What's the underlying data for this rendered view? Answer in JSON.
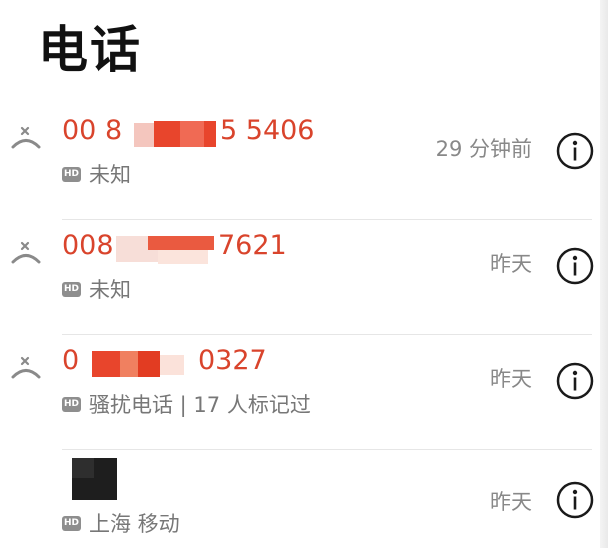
{
  "header": {
    "title": "电话"
  },
  "calls": [
    {
      "number_prefix": "00 8",
      "number_suffix": "5 5406",
      "location": "未知",
      "time": "29 分钟前",
      "badge": "HD",
      "missed": true
    },
    {
      "number_prefix": "008",
      "number_suffix": "7621",
      "location": "未知",
      "time": "昨天",
      "badge": "HD",
      "missed": true
    },
    {
      "number_prefix": "0",
      "number_suffix": "0327",
      "location": "骚扰电话 | 17 人标记过",
      "time": "昨天",
      "badge": "HD",
      "missed": true
    },
    {
      "location": "上海 移动",
      "time": "昨天",
      "badge": "HD",
      "missed": false
    }
  ],
  "icons": {
    "missed_call": "missed-call-icon",
    "info": "info-icon",
    "hd": "hd-badge"
  },
  "colors": {
    "missed_number": "#d9442c",
    "secondary_text": "#777777",
    "title": "#111111"
  }
}
